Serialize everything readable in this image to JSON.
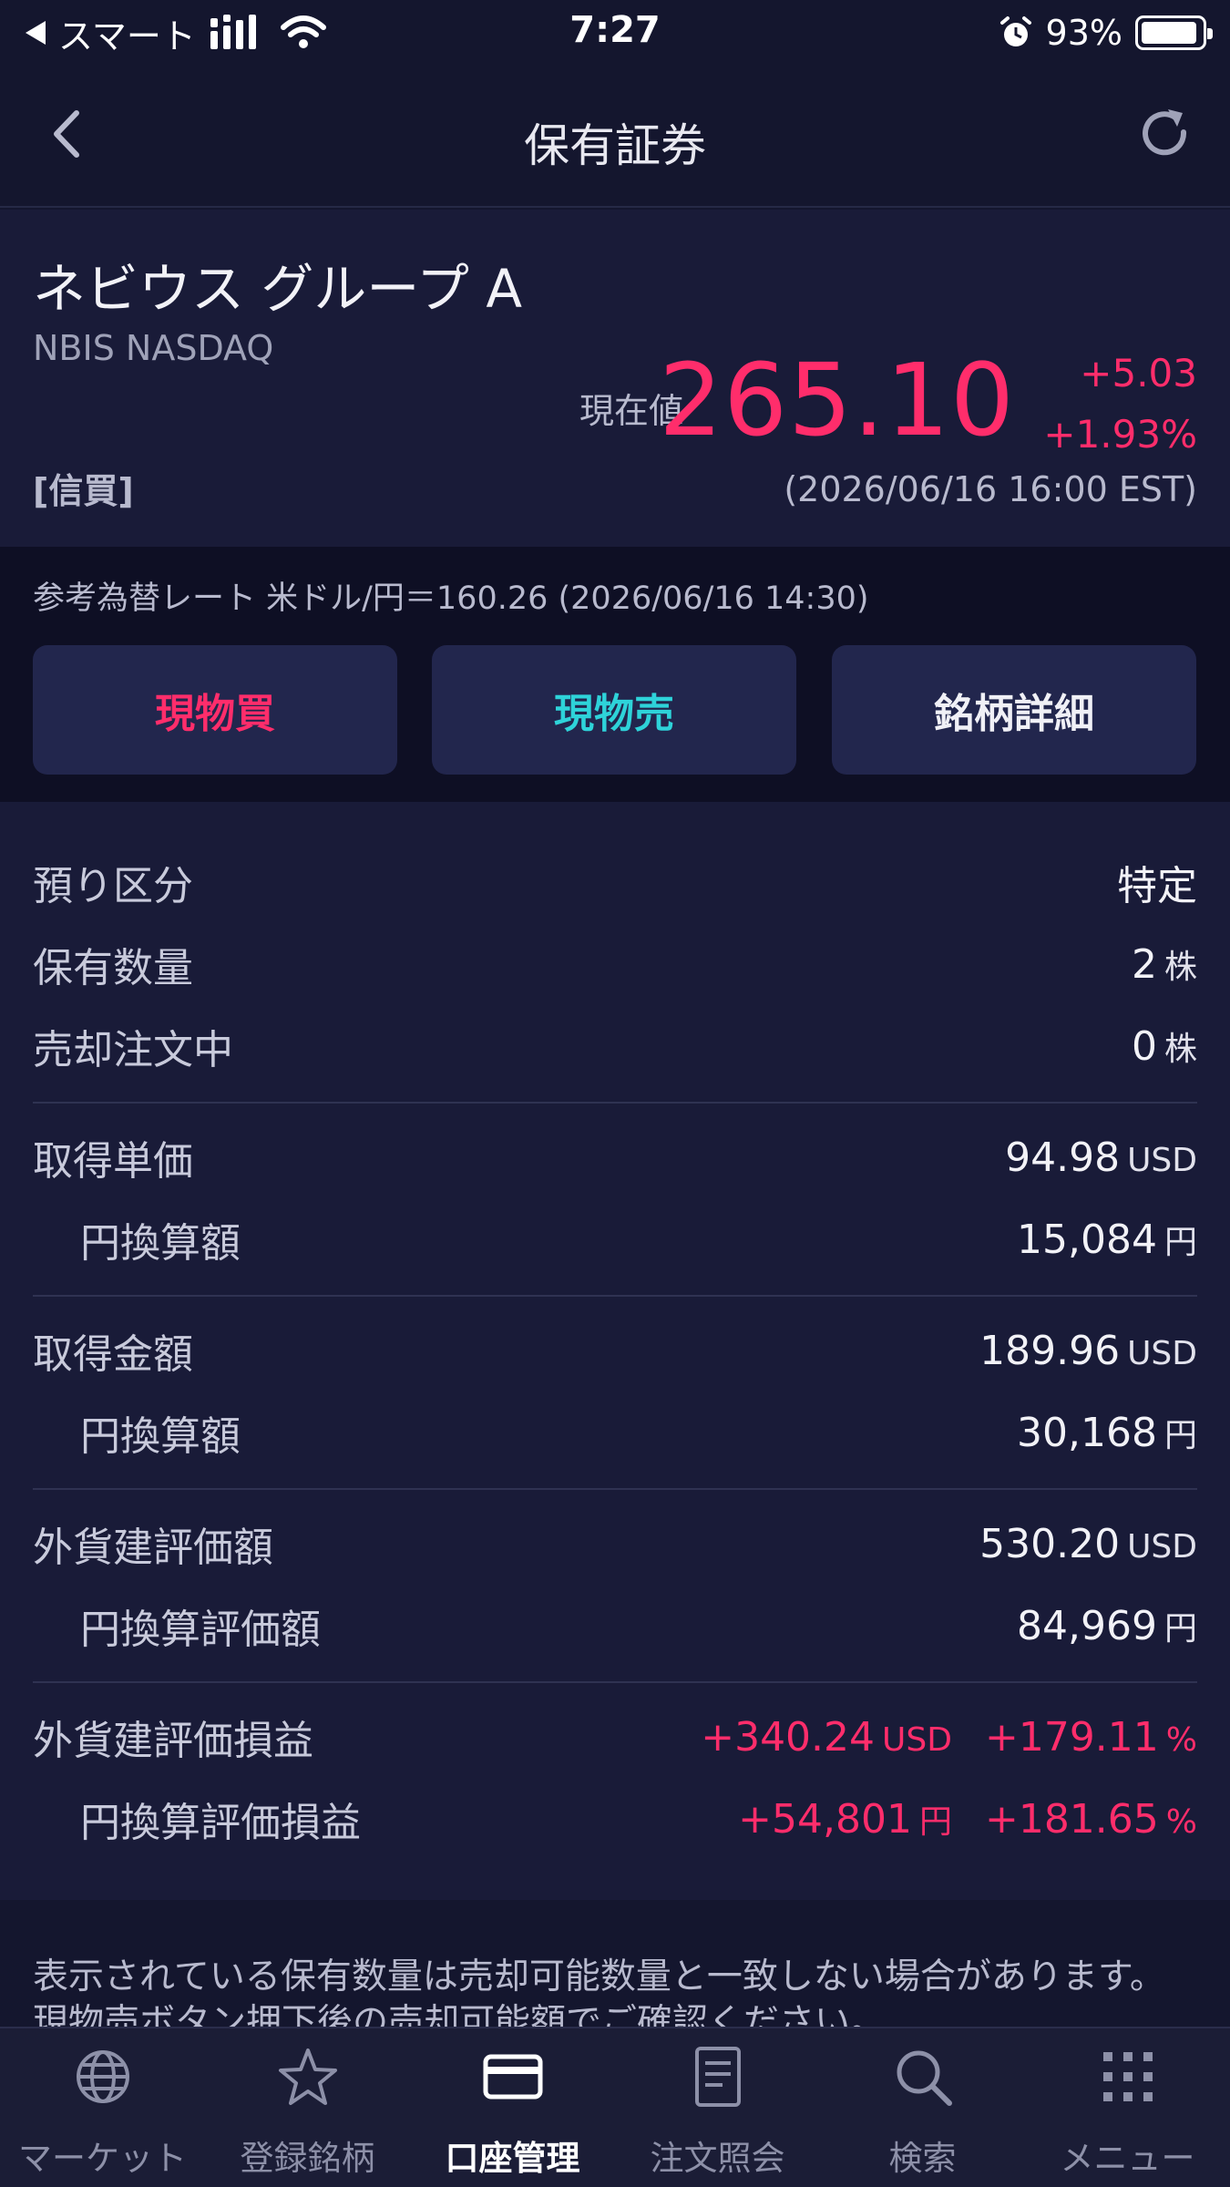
{
  "status_bar": {
    "carrier": "スマート",
    "time": "7:27",
    "battery_pct": "93%",
    "battery_level": 0.93,
    "icons": [
      "back-triangle-icon",
      "signal-icon",
      "wifi-icon",
      "alarm-icon",
      "battery-icon"
    ]
  },
  "nav": {
    "title": "保有証券",
    "back_icon": "chevron-left-icon",
    "refresh_icon": "refresh-icon"
  },
  "stock": {
    "name": "ネビウス グループ A",
    "code": "NBIS NASDAQ",
    "account_type": "[信買]",
    "price_label": "現在値",
    "price": "265.10",
    "change": "+5.03",
    "change_pct": "+1.93%",
    "timestamp": "(2026/06/16 16:00 EST)"
  },
  "exchange": {
    "rate_text": "参考為替レート 米ドル/円＝160.26 (2026/06/16 14:30)"
  },
  "actions": {
    "buy": "現物買",
    "sell": "現物売",
    "detail": "銘柄詳細"
  },
  "details": {
    "deposit_type": {
      "label": "預り区分",
      "value": "特定"
    },
    "quantity": {
      "label": "保有数量",
      "value": "2",
      "unit": "株"
    },
    "selling": {
      "label": "売却注文中",
      "value": "0",
      "unit": "株"
    },
    "unit_cost": {
      "label": "取得単価",
      "value": "94.98",
      "unit": "USD"
    },
    "unit_cost_jpy": {
      "label": "円換算額",
      "value": "15,084",
      "unit": "円"
    },
    "cost_total": {
      "label": "取得金額",
      "value": "189.96",
      "unit": "USD"
    },
    "cost_total_jpy": {
      "label": "円換算額",
      "value": "30,168",
      "unit": "円"
    },
    "valuation": {
      "label": "外貨建評価額",
      "value": "530.20",
      "unit": "USD"
    },
    "valuation_jpy": {
      "label": "円換算評価額",
      "value": "84,969",
      "unit": "円"
    },
    "pl": {
      "label": "外貨建評価損益",
      "value": "+340.24",
      "unit": "USD",
      "pct": "+179.11",
      "pct_unit": "%"
    },
    "pl_jpy": {
      "label": "円換算評価損益",
      "value": "+54,801",
      "unit": "円",
      "pct": "+181.65",
      "pct_unit": "%"
    }
  },
  "note": "表示されている保有数量は売却可能数量と一致しない場合があります。現物売ボタン押下後の売却可能額でご確認ください。",
  "tabs": [
    {
      "label": "マーケット",
      "icon": "globe-icon"
    },
    {
      "label": "登録銘柄",
      "icon": "star-icon"
    },
    {
      "label": "口座管理",
      "icon": "card-icon",
      "active": true
    },
    {
      "label": "注文照会",
      "icon": "document-icon"
    },
    {
      "label": "検索",
      "icon": "search-icon"
    },
    {
      "label": "メニュー",
      "icon": "grid-menu-icon"
    }
  ],
  "colors": {
    "background": "#14162e",
    "panel": "#191b38",
    "band": "#0e0f24",
    "button": "#22264d",
    "positive": "#ff2d6b",
    "sell": "#2ed3d9"
  }
}
